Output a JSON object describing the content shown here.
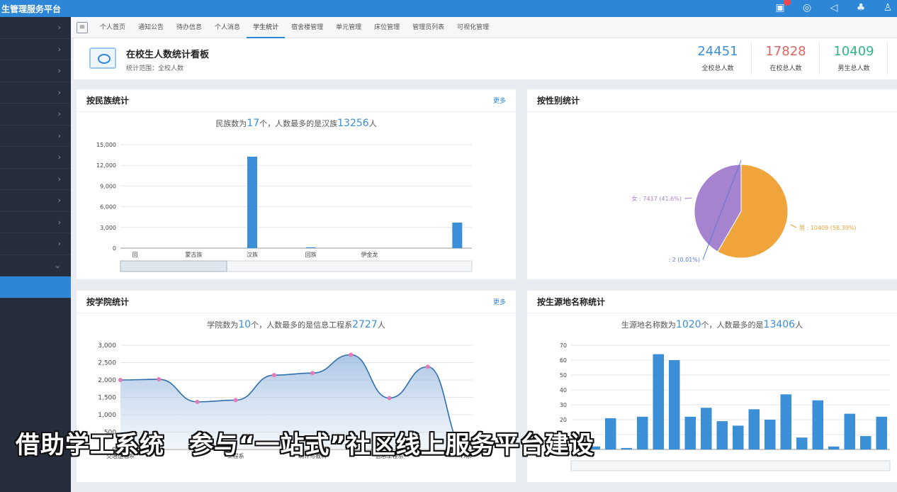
{
  "topbar": {
    "title": "生管理服务平台",
    "icons": [
      "notification-icon",
      "chat-icon",
      "volume-icon",
      "shirt-icon",
      "user-icon"
    ]
  },
  "sidebar": {
    "items": [
      "›",
      "›",
      "›",
      "›",
      "›",
      "›",
      "›",
      "›",
      "›",
      "›",
      "›",
      "⌄",
      ""
    ]
  },
  "tabs": [
    "个人首页",
    "通知公告",
    "待办信息",
    "个人消息",
    "学生统计",
    "宿舍楼管理",
    "单元管理",
    "床位管理",
    "管理员列表",
    "可视化管理"
  ],
  "active_tab": 4,
  "header": {
    "title": "在校生人数统计看板",
    "range": "统计范围：全校人数",
    "stats": [
      {
        "value": "24451",
        "label": "全校总人数",
        "color": "#3a8fd6"
      },
      {
        "value": "17828",
        "label": "在校总人数",
        "color": "#e06464"
      },
      {
        "value": "10409",
        "label": "男生总人数",
        "color": "#2fb58a"
      }
    ]
  },
  "ethnic": {
    "title": "按民族统计",
    "more": "更多",
    "summary_pre": "民族数为",
    "count": "17",
    "summary_mid": "个，人数最多的是汉族",
    "max": "13256",
    "summary_post": "人"
  },
  "gender": {
    "title": "按性别统计"
  },
  "college": {
    "title": "按学院统计",
    "more": "更多",
    "summary_pre": "学院数为",
    "count": "10",
    "summary_mid": "个，人数最多的是信息工程系",
    "max": "2727",
    "summary_post": "人"
  },
  "origin": {
    "title": "按生源地名称统计",
    "summary_pre": "生源地名称数为",
    "count": "1020",
    "summary_mid": "个，人数最多的是",
    "max": "13406",
    "summary_post": "人"
  },
  "caption": "借助学工系统　参与“一站式”社区线上服务平台建设",
  "chart_data": [
    {
      "type": "bar",
      "title": "按民族统计",
      "categories": [
        "回",
        "",
        "蒙古族",
        "",
        "汉族",
        "",
        "回族",
        "",
        "伊金龙",
        "",
        "",
        ""
      ],
      "values": [
        0,
        0,
        0,
        0,
        13256,
        0,
        120,
        0,
        0,
        0,
        0,
        3700
      ],
      "ylim": [
        0,
        15000
      ],
      "yticks": [
        "0",
        "3,000",
        "6,000",
        "9,000",
        "12,000",
        "15,000"
      ]
    },
    {
      "type": "pie",
      "title": "按性别统计",
      "slices": [
        {
          "name": "男",
          "value": 10409,
          "label": "男 : 10409 (58.39%)",
          "color": "#f0a43c"
        },
        {
          "name": "女",
          "value": 7417,
          "label": "女 : 7417 (41.6%)",
          "color": "#a583cf"
        },
        {
          "name": "",
          "value": 2,
          "label": ": 2 (0.01%)",
          "color": "#5b7bd5"
        }
      ]
    },
    {
      "type": "area",
      "title": "按学院统计",
      "categories": [
        "交通运输系",
        "",
        "",
        "工程系",
        "",
        "统计与教科",
        "",
        "信息工程系",
        "",
        "IT系"
      ],
      "values": [
        2000,
        2020,
        1370,
        1420,
        2140,
        2200,
        2727,
        1480,
        2380,
        0
      ],
      "ylim": [
        0,
        3000
      ],
      "yticks": [
        "0",
        "500",
        "1,000",
        "1,500",
        "2,000",
        "2,500",
        "3,000"
      ]
    },
    {
      "type": "bar",
      "title": "按生源地名称统计",
      "values": [
        2,
        2,
        21,
        1,
        22,
        64,
        60,
        22,
        28,
        19,
        16,
        27,
        20,
        37,
        8,
        33,
        2,
        24,
        9,
        22
      ],
      "ylim": [
        0,
        70
      ],
      "yticks": [
        "0",
        "10",
        "20",
        "30",
        "40",
        "50",
        "60",
        "70"
      ]
    }
  ]
}
